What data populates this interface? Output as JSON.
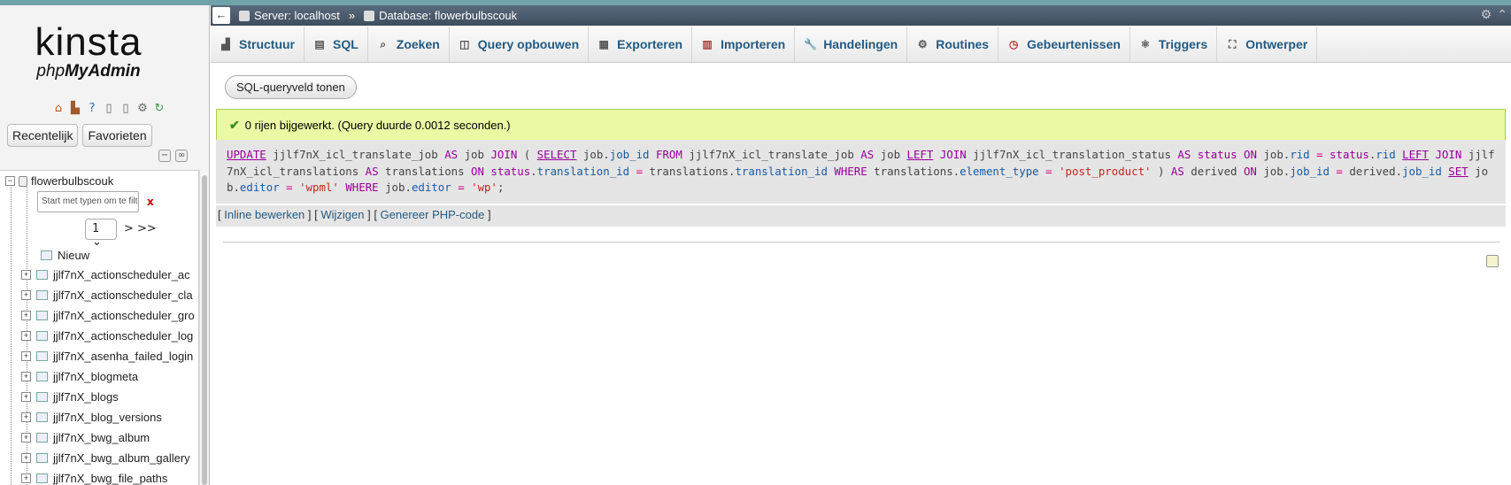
{
  "sidebar": {
    "logo_main": "kinsta",
    "logo_sub_prefix": "php",
    "logo_sub_brand": "MyAdmin",
    "icons": [
      "home-icon",
      "exit-icon",
      "help-icon",
      "docs-icon",
      "copy-icon",
      "settings-icon",
      "reload-icon"
    ],
    "recent_label": "Recentelijk",
    "favorites_label": "Favorieten",
    "database_name": "flowerbulbscouk",
    "filter_placeholder": "Start met typen om te filte",
    "filter_clear": "x",
    "page_select_value": "1",
    "page_next": "> >>",
    "new_label": "Nieuw",
    "tables": [
      "jjlf7nX_actionscheduler_ac",
      "jjlf7nX_actionscheduler_cla",
      "jjlf7nX_actionscheduler_gro",
      "jjlf7nX_actionscheduler_log",
      "jjlf7nX_asenha_failed_login",
      "jjlf7nX_blogmeta",
      "jjlf7nX_blogs",
      "jjlf7nX_blog_versions",
      "jjlf7nX_bwg_album",
      "jjlf7nX_bwg_album_gallery",
      "jjlf7nX_bwg_file_paths"
    ]
  },
  "header": {
    "back": "←",
    "server_label": "Server: localhost",
    "separator": "»",
    "database_label": "Database: flowerbulbscouk"
  },
  "tabs": [
    {
      "label": "Structuur",
      "icon": "structure-icon"
    },
    {
      "label": "SQL",
      "icon": "sql-icon"
    },
    {
      "label": "Zoeken",
      "icon": "search-icon"
    },
    {
      "label": "Query opbouwen",
      "icon": "query-icon"
    },
    {
      "label": "Exporteren",
      "icon": "export-icon"
    },
    {
      "label": "Importeren",
      "icon": "import-icon"
    },
    {
      "label": "Handelingen",
      "icon": "wrench-icon"
    },
    {
      "label": "Routines",
      "icon": "routines-icon"
    },
    {
      "label": "Gebeurtenissen",
      "icon": "clock-icon"
    },
    {
      "label": "Triggers",
      "icon": "triggers-icon"
    },
    {
      "label": "Ontwerper",
      "icon": "designer-icon"
    }
  ],
  "content": {
    "show_sql_button": "SQL-queryveld tonen",
    "success_message": "0 rijen bijgewerkt. (Query duurde 0.0012 seconden.)",
    "sql": {
      "t1": "jjlf7nX_icl_translate_job",
      "t2": "jjlf7nX_icl_translate_job",
      "t3": "jjlf7nX_icl_translation_status",
      "t4": "jjlf7nX_icl_translations",
      "val1": "'post_product'",
      "val2": "'wpml'",
      "val3": "'wp'"
    },
    "actions": {
      "inline_edit": "Inline bewerken",
      "edit": "Wijzigen",
      "php_code": "Genereer PHP-code"
    }
  }
}
